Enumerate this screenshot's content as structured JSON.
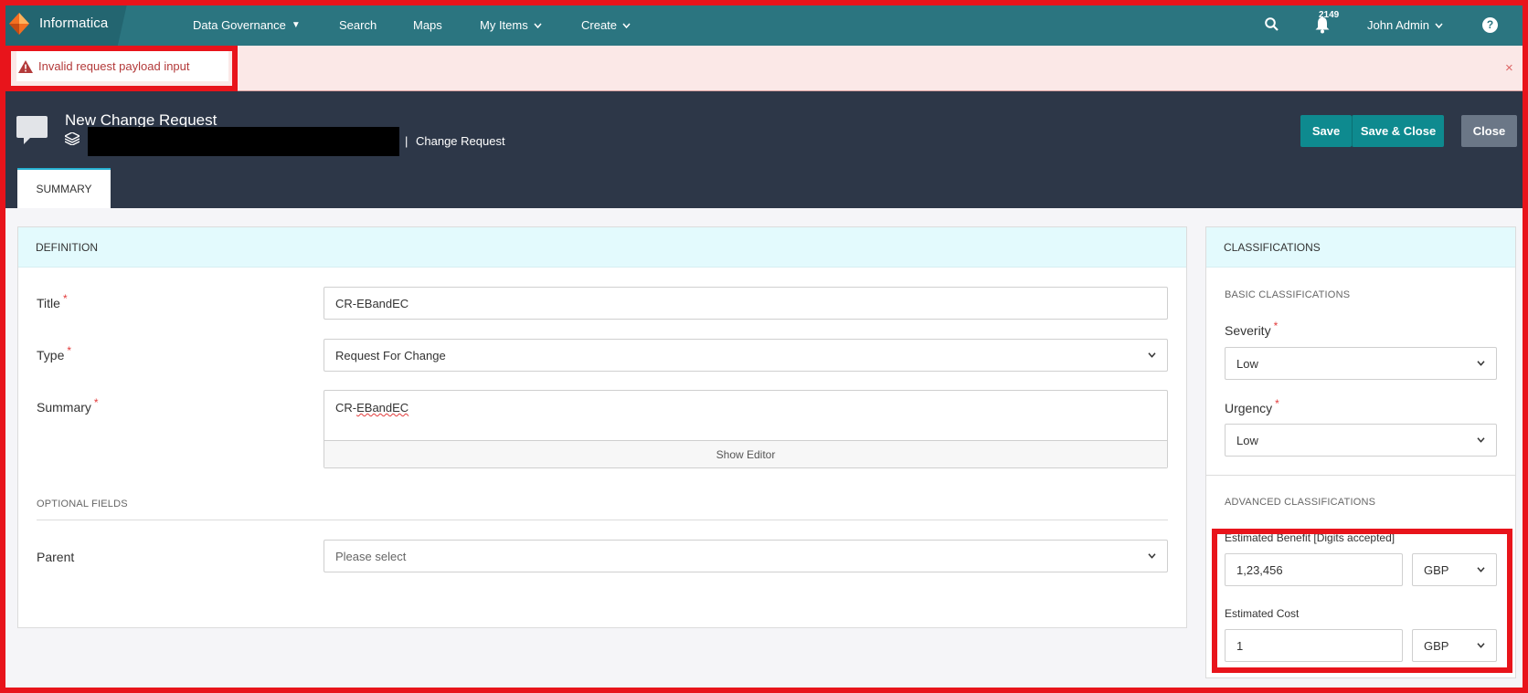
{
  "nav": {
    "logo": "Informatica",
    "items": [
      {
        "label": "Data Governance",
        "has_caret": true
      },
      {
        "label": "Search",
        "has_caret": false
      },
      {
        "label": "Maps",
        "has_caret": false
      },
      {
        "label": "My Items",
        "has_caret": true
      },
      {
        "label": "Create",
        "has_caret": true
      }
    ],
    "notification_count": "2149",
    "user": "John Admin",
    "help": "?"
  },
  "error": {
    "message": "Invalid request payload input",
    "close": "×"
  },
  "header": {
    "title": "New Change Request",
    "separator": "|",
    "subtitle": "Change Request",
    "save": "Save",
    "save_close": "Save & Close",
    "close": "Close",
    "tab": "SUMMARY"
  },
  "definition": {
    "header": "DEFINITION",
    "title_label": "Title",
    "title_value": "CR-EBandEC",
    "type_label": "Type",
    "type_value": "Request For Change",
    "summary_label": "Summary",
    "summary_prefix": "CR-",
    "summary_squiggle": "EBandEC",
    "show_editor": "Show Editor",
    "optional_fields": "OPTIONAL FIELDS",
    "parent_label": "Parent",
    "parent_placeholder": "Please select",
    "required_mark": "*"
  },
  "classifications": {
    "header": "CLASSIFICATIONS",
    "basic": "BASIC CLASSIFICATIONS",
    "severity_label": "Severity",
    "severity_value": "Low",
    "urgency_label": "Urgency",
    "urgency_value": "Low",
    "advanced": "ADVANCED CLASSIFICATIONS",
    "benefit_label": "Estimated Benefit [Digits accepted]",
    "benefit_value": "1,23,456",
    "benefit_currency": "GBP",
    "cost_label": "Estimated Cost",
    "cost_value": "1",
    "cost_currency": "GBP"
  },
  "colors": {
    "nav": "#2b7580",
    "header": "#2d3748",
    "accent_button": "#0e8a8f",
    "highlight": "#e8141b"
  }
}
